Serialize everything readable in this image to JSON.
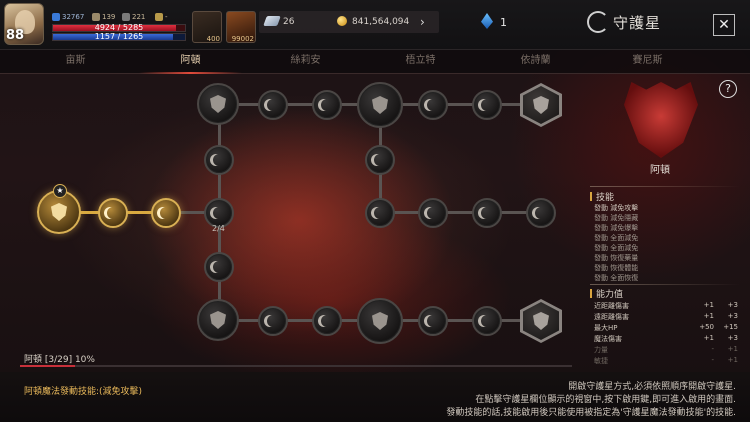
{
  "player": {
    "level": "88",
    "stat1": "32767",
    "stat2": "139",
    "stat3": "221",
    "stat4": "-",
    "hp_text": "4924 / 5285",
    "hp_ratio": 0.93,
    "mp_text": "1157 / 1265",
    "mp_ratio": 0.91
  },
  "slots": [
    {
      "num": "400"
    },
    {
      "num": "99002"
    }
  ],
  "resources": {
    "feather": "26",
    "gold": "841,564,094",
    "gem": "1"
  },
  "title": "守護星",
  "close_label": "✕",
  "tabs": [
    {
      "label": "亩斯"
    },
    {
      "label": "阿頓"
    },
    {
      "label": "絲莉安"
    },
    {
      "label": "梧立特"
    },
    {
      "label": "依詩蘭"
    },
    {
      "label": "賽尼斯"
    }
  ],
  "active_tab": 1,
  "tree": {
    "branch_count": "2/4"
  },
  "constellation": {
    "name": "阿頓",
    "help": "?"
  },
  "skills": {
    "title": "技能",
    "lines": [
      "發動 減免攻擊",
      "發動 減免隱藏",
      "發動 減免爆擊",
      "發動 全面減免",
      "發動 全面減免",
      "發動 恢復藥量",
      "發動 恢復體能",
      "發動 全面恢復"
    ]
  },
  "abilities": {
    "title": "能力值",
    "rows": [
      {
        "name": "近距離傷害",
        "v1": "+1",
        "v2": "+3"
      },
      {
        "name": "遠距離傷害",
        "v1": "+1",
        "v2": "+3"
      },
      {
        "name": "最大HP",
        "v1": "+50",
        "v2": "+15"
      },
      {
        "name": "魔法傷害",
        "v1": "+1",
        "v2": "+3"
      },
      {
        "name": "力量",
        "v1": "-",
        "v2": "+1"
      },
      {
        "name": "敏捷",
        "v1": "-",
        "v2": "+1"
      }
    ]
  },
  "progress": {
    "label": "阿頓 [3/29] 10%",
    "ratio": 0.1
  },
  "magic_skill": "阿頓魔法發動技能:(減免攻擊)",
  "help_lines": [
    "開啟守護星方式,必須依照順序開啟守護星.",
    "在點擊守護星欄位顯示的視窗中,按下啟用鍵,即可進入啟用的畫面.",
    "發動技能的話,技能啟用後只能使用被指定為'守護星魔法發動技能'的技能."
  ]
}
